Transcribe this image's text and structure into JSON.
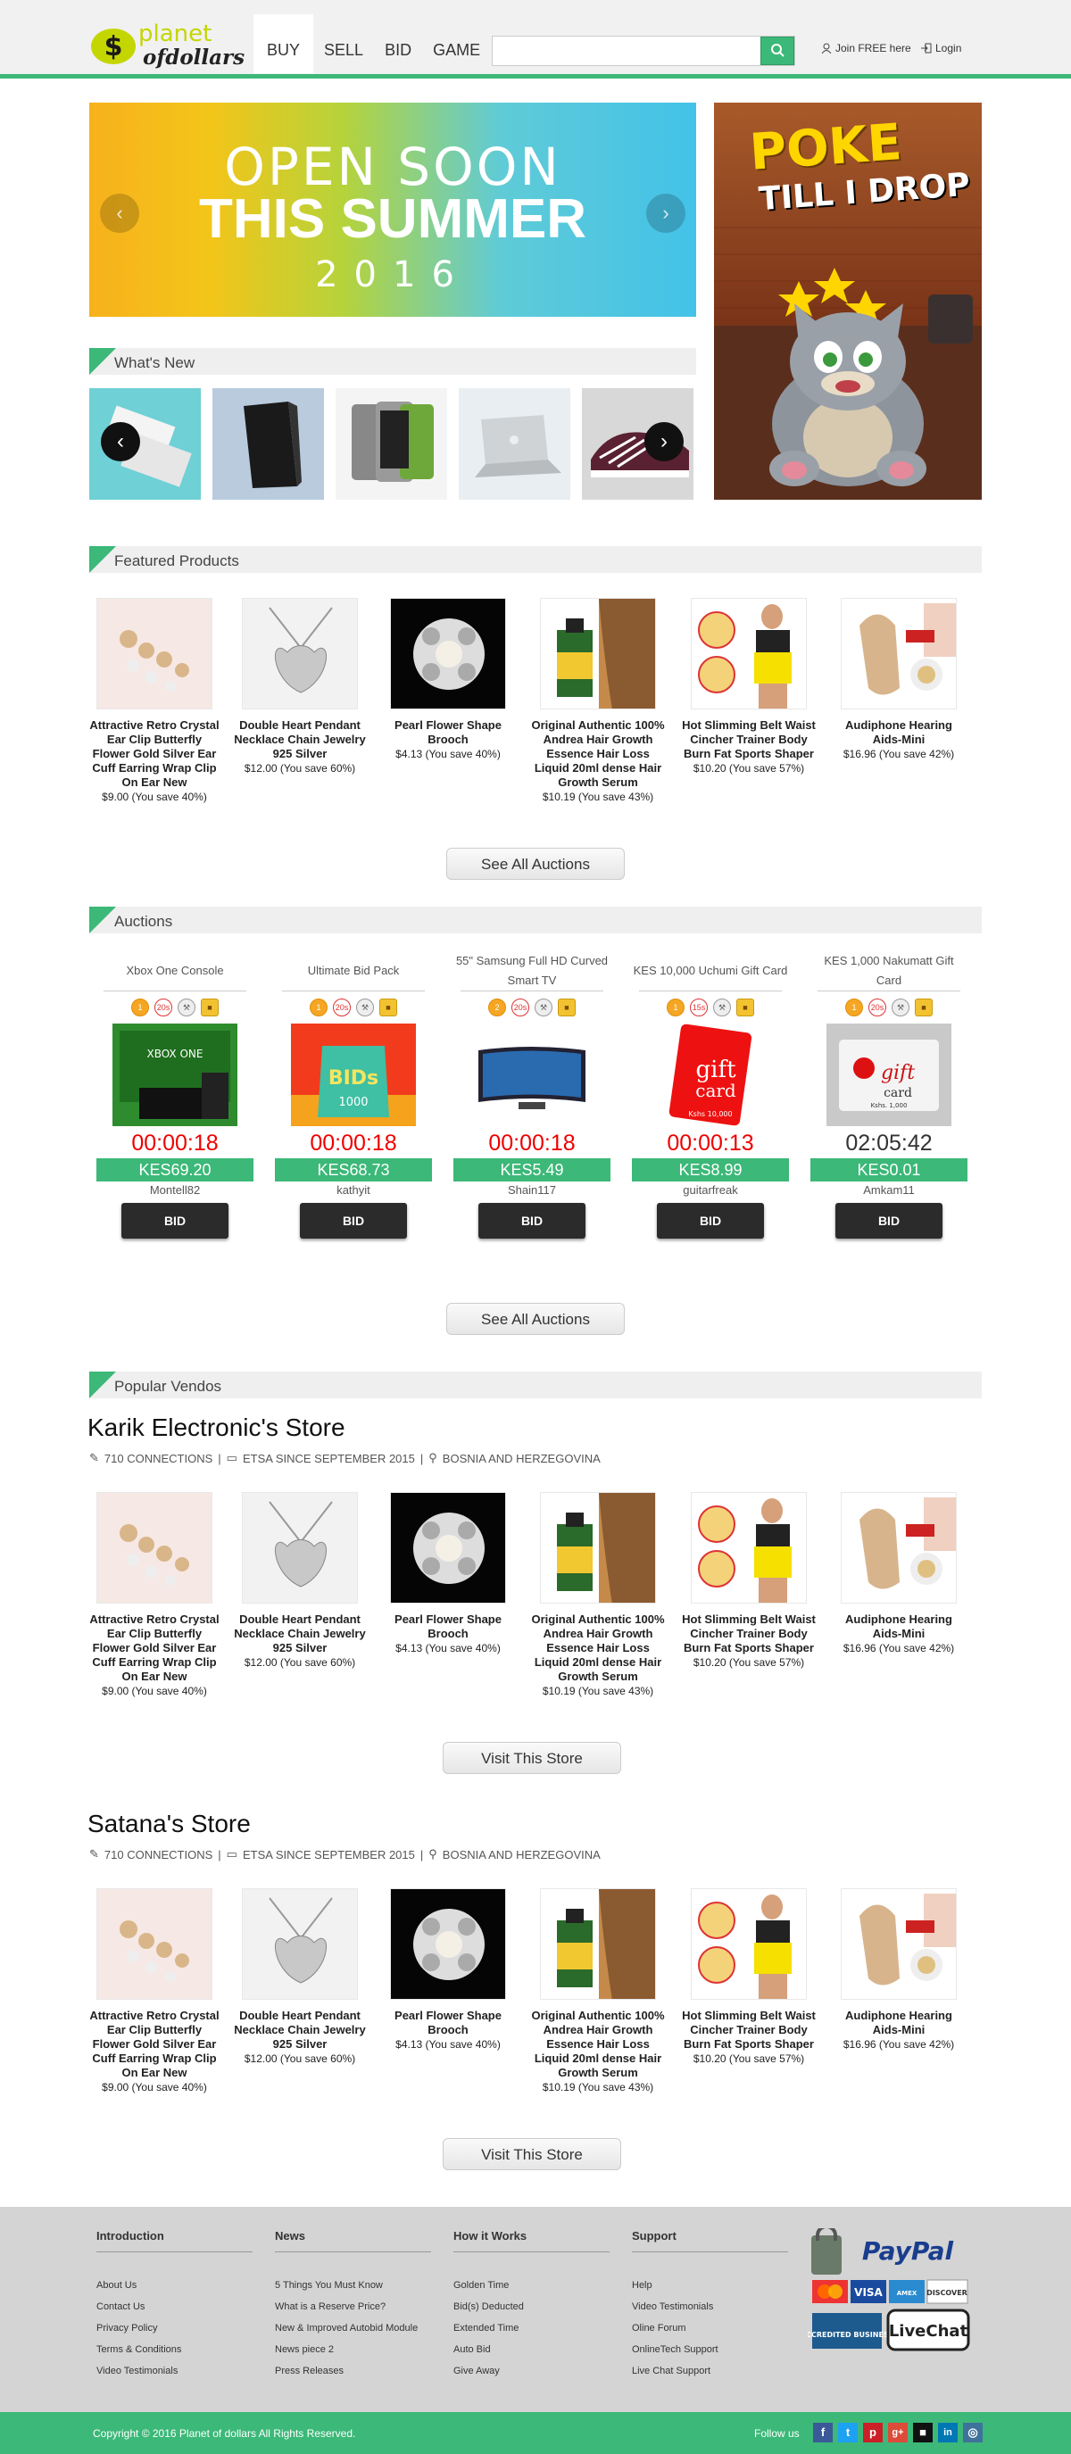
{
  "header": {
    "logo_top": "planet",
    "logo_bottom": "ofdollars",
    "logo_symbol": "$",
    "nav": [
      "BUY",
      "SELL",
      "BID",
      "GAME"
    ],
    "search_placeholder": "",
    "join": "Join FREE here",
    "login": "Login"
  },
  "banner": {
    "line1": "OPEN SOON",
    "line2": "THIS SUMMER",
    "line3": "2016",
    "prev": "‹",
    "next": "›"
  },
  "side_ad": {
    "line1": "POKE",
    "line2": "TILL I DROP"
  },
  "whats_new": {
    "title": "What's New",
    "prev": "‹",
    "next": "›"
  },
  "featured": {
    "title": "Featured Products"
  },
  "products": [
    {
      "name": "Attractive Retro Crystal Ear Clip Butterfly Flower Gold Silver Ear Cuff Earring Wrap Clip On Ear New",
      "price": "$9.00 (You save 40%)"
    },
    {
      "name": "Double Heart Pendant Necklace Chain Jewelry 925 Silver",
      "price": "$12.00 (You save 60%)"
    },
    {
      "name": "Pearl Flower Shape Brooch",
      "price": "$4.13 (You save 40%)"
    },
    {
      "name": "Original Authentic 100% Andrea Hair Growth Essence Hair Loss Liquid 20ml dense Hair Growth Serum",
      "price": "$10.19 (You save 43%)"
    },
    {
      "name": "Hot Slimming Belt Waist Cincher Trainer Body Burn Fat Sports Shaper",
      "price": "$10.20 (You save 57%)"
    },
    {
      "name": "Audiphone Hearing Aids-Mini",
      "price": "$16.96 (You save 42%)"
    }
  ],
  "see_all_products": "See All Auctions",
  "auctions_section": {
    "title": "Auctions",
    "see_all": "See All Auctions"
  },
  "auctions": [
    {
      "title": "Xbox One Console",
      "icons": [
        "1",
        "20s",
        "",
        ""
      ],
      "timer": "00:00:18",
      "price": "KES69.20",
      "user": "Montell82",
      "bid": "BID"
    },
    {
      "title": "Ultimate Bid Pack",
      "icons": [
        "1",
        "20s",
        "",
        ""
      ],
      "timer": "00:00:18",
      "price": "KES68.73",
      "user": "kathyit",
      "bid": "BID"
    },
    {
      "title": "55\" Samsung Full HD Curved Smart TV",
      "icons": [
        "2",
        "20s",
        "",
        ""
      ],
      "timer": "00:00:18",
      "price": "KES5.49",
      "user": "Shain117",
      "bid": "BID"
    },
    {
      "title": "KES 10,000 Uchumi Gift Card",
      "icons": [
        "1",
        "15s",
        "",
        ""
      ],
      "timer": "00:00:13",
      "price": "KES8.99",
      "user": "guitarfreak",
      "bid": "BID"
    },
    {
      "title": "KES 1,000 Nakumatt Gift Card",
      "icons": [
        "1",
        "20s",
        "",
        ""
      ],
      "timer": "02:05:42",
      "price": "KES0.01",
      "user": "Amkam11",
      "bid": "BID"
    }
  ],
  "auction_img_text": {
    "xbox": "XBOX ONE",
    "bids": "BIDs",
    "bids_num": "1000",
    "gift": "gift",
    "card": "card",
    "kes10000": "Kshs 10,000",
    "kes1000": "Kshs. 1,000"
  },
  "popular": {
    "title": "Popular Vendos"
  },
  "stores": [
    {
      "name": "Karik Electronic's Store",
      "connections": "710 CONNECTIONS",
      "since": "ETSA SINCE SEPTEMBER 2015",
      "location": "BOSNIA AND HERZEGOVINA",
      "visit": "Visit This Store"
    },
    {
      "name": "Satana's Store",
      "connections": "710 CONNECTIONS",
      "since": "ETSA SINCE SEPTEMBER 2015",
      "location": "BOSNIA AND HERZEGOVINA",
      "visit": "Visit This Store"
    }
  ],
  "footer": {
    "columns": [
      {
        "heading": "Introduction",
        "items": [
          "About Us",
          "Contact Us",
          "Privacy Policy",
          "Terms & Conditions",
          "Video Testimonials"
        ]
      },
      {
        "heading": "News",
        "items": [
          "5 Things You Must Know",
          "What is a Reserve Price?",
          "New & Improved Autobid Module",
          "News piece 2",
          "Press Releases"
        ]
      },
      {
        "heading": "How it Works",
        "items": [
          "Golden Time",
          "Bid(s) Deducted",
          "Extended Time",
          "Auto Bid",
          "Give Away"
        ]
      },
      {
        "heading": "Support",
        "items": [
          "Help",
          "Video Testimonials",
          "Oline Forum",
          "OnlineTech Support",
          "Live Chat Support"
        ]
      }
    ],
    "paypal": "PayPal",
    "cards": [
      "MasterCard",
      "VISA",
      "AMEX",
      "DISCOVER"
    ],
    "bbb": "ACCREDITED BUSINESS",
    "livechat": "LiveChat",
    "copyright": "Copyright © 2016 Planet of dollars All Rights Reserved.",
    "follow": "Follow us",
    "social": [
      "f",
      "t",
      "p",
      "g+",
      "",
      "in",
      ""
    ]
  }
}
